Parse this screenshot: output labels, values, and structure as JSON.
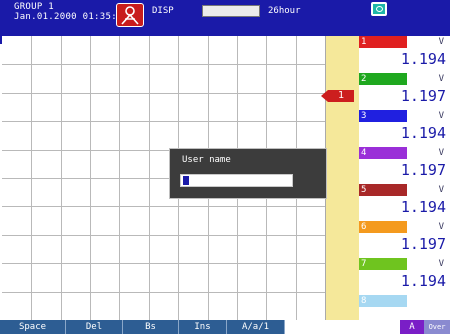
{
  "header": {
    "group": "GROUP 1",
    "datetime": "Jan.01.2000 01:35:29",
    "disp_label": "DISP",
    "hours": "26hour",
    "logo_icon": "alarm-logo-icon",
    "snapshot_icon": "camera-icon"
  },
  "trend": {
    "marker_label": "1",
    "grid_columns": 11,
    "grid_rows": 10
  },
  "channels": [
    {
      "num": "1",
      "unit": "V",
      "value": "1.194",
      "color": "#e02020"
    },
    {
      "num": "2",
      "unit": "V",
      "value": "1.197",
      "color": "#1fa81f"
    },
    {
      "num": "3",
      "unit": "V",
      "value": "1.194",
      "color": "#2020e0"
    },
    {
      "num": "4",
      "unit": "V",
      "value": "1.197",
      "color": "#9a2fd8"
    },
    {
      "num": "5",
      "unit": "V",
      "value": "1.194",
      "color": "#a82828"
    },
    {
      "num": "6",
      "unit": "V",
      "value": "1.197",
      "color": "#f49a1e"
    },
    {
      "num": "7",
      "unit": "V",
      "value": "1.194",
      "color": "#6fc41f"
    },
    {
      "num": "8",
      "unit": "",
      "value": "",
      "color": "#a6d8f2"
    }
  ],
  "dialog": {
    "title": "User name",
    "input_value": ""
  },
  "softkeys": [
    "Space",
    "Del",
    "Bs",
    "Ins",
    "A/a/1"
  ],
  "status": {
    "mode": "A",
    "over": "Over"
  }
}
